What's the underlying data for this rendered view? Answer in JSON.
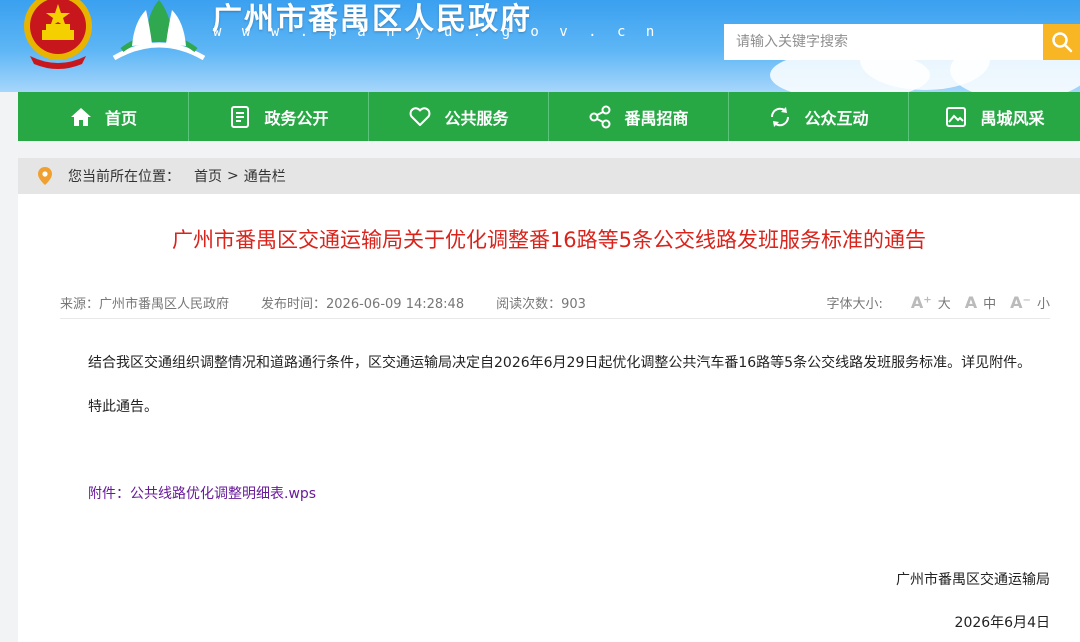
{
  "header": {
    "site_name": "广州市番禺区人民政府",
    "site_url": "w w w . p a n y u . g o v . c n",
    "search_placeholder": "请输入关键字搜索"
  },
  "nav": {
    "items": [
      {
        "label": "首页",
        "icon": "home-icon"
      },
      {
        "label": "政务公开",
        "icon": "document-icon"
      },
      {
        "label": "公共服务",
        "icon": "heart-icon"
      },
      {
        "label": "番禺招商",
        "icon": "share-icon"
      },
      {
        "label": "公众互动",
        "icon": "refresh-icon"
      },
      {
        "label": "禺城风采",
        "icon": "image-icon"
      }
    ]
  },
  "breadcrumb": {
    "prefix": "您当前所在位置：",
    "home": "首页",
    "separator": ">",
    "current": "通告栏"
  },
  "article": {
    "title": "广州市番禺区交通运输局关于优化调整番16路等5条公交线路发班服务标准的通告",
    "source": "来源：广州市番禺区人民政府",
    "published": "发布时间：2026-06-09 14:28:48",
    "views": "阅读次数：903",
    "font_size_label": "字体大小:",
    "font_large": "大",
    "font_medium": "中",
    "font_small": "小",
    "body_1": "结合我区交通组织调整情况和道路通行条件，区交通运输局决定自2026年6月29日起优化调整公共汽车番16路等5条公交线路发班服务标准。详见附件。",
    "body_2": "特此通告。",
    "attachment_label": "附件：",
    "attachment_file": "公共线路优化调整明细表.wps",
    "signature": "广州市番禺区交通运输局",
    "date": "2026年6月4日"
  },
  "colors": {
    "nav_green": "#28a745",
    "title_red": "#d9241c",
    "search_button": "#f8b524",
    "attachment_purple": "#6a1b9a",
    "pin_orange": "#f0a030"
  }
}
